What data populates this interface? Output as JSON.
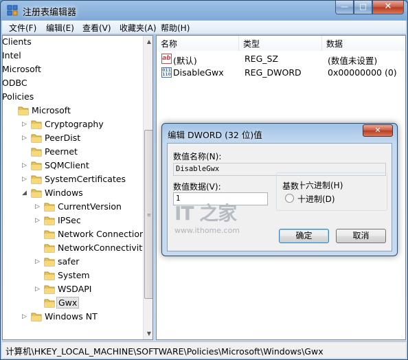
{
  "window": {
    "title": "注册表编辑器"
  },
  "titlebar": {
    "minimize": "—",
    "maximize": "□",
    "close": "✕"
  },
  "menu": [
    "文件(F)",
    "编辑(E)",
    "查看(V)",
    "收藏夹(A)",
    "帮助(H)"
  ],
  "tree": {
    "items": [
      {
        "label": "Clients",
        "level": 0,
        "expander": ""
      },
      {
        "label": "Intel",
        "level": 0,
        "expander": ""
      },
      {
        "label": "Microsoft",
        "level": 0,
        "expander": ""
      },
      {
        "label": "ODBC",
        "level": 0,
        "expander": ""
      },
      {
        "label": "Policies",
        "level": 0,
        "expander": ""
      },
      {
        "label": "Microsoft",
        "level": 1,
        "expander": ""
      },
      {
        "label": "Cryptography",
        "level": 2,
        "expander": "▷"
      },
      {
        "label": "PeerDist",
        "level": 2,
        "expander": "▷"
      },
      {
        "label": "Peernet",
        "level": 2,
        "expander": ""
      },
      {
        "label": "SQMClient",
        "level": 2,
        "expander": "▷"
      },
      {
        "label": "SystemCertificates",
        "level": 2,
        "expander": "▷"
      },
      {
        "label": "Windows",
        "level": 2,
        "expander": "◢"
      },
      {
        "label": "CurrentVersion",
        "level": 3,
        "expander": "▷"
      },
      {
        "label": "IPSec",
        "level": 3,
        "expander": "▷"
      },
      {
        "label": "Network Connections",
        "level": 3,
        "expander": ""
      },
      {
        "label": "NetworkConnectivityStat",
        "level": 3,
        "expander": ""
      },
      {
        "label": "safer",
        "level": 3,
        "expander": "▷"
      },
      {
        "label": "System",
        "level": 3,
        "expander": ""
      },
      {
        "label": "WSDAPI",
        "level": 3,
        "expander": "▷"
      },
      {
        "label": "Gwx",
        "level": 3,
        "expander": "",
        "selected": true
      },
      {
        "label": "Windows NT",
        "level": 2,
        "expander": "▷"
      }
    ],
    "scroll_up": "▲",
    "scroll_down": "▼",
    "scroll_grip": "≡"
  },
  "list": {
    "columns": [
      "名称",
      "类型",
      "数据"
    ],
    "rows": [
      {
        "icon": "string-value-icon",
        "icon_text": "ab",
        "name": "(默认)",
        "type": "REG_SZ",
        "data": "(数值未设置)"
      },
      {
        "icon": "binary-value-icon",
        "icon_text": "011\n110",
        "name": "DisableGwx",
        "type": "REG_DWORD",
        "data": "0x00000000 (0)"
      }
    ]
  },
  "statusbar": {
    "path": "计算机\\HKEY_LOCAL_MACHINE\\SOFTWARE\\Policies\\Microsoft\\Windows\\Gwx"
  },
  "dialog": {
    "title": "编辑 DWORD (32 位)值",
    "close": "✕",
    "name_label": "数值名称(N):",
    "name_value": "DisableGwx",
    "data_label": "数值数据(V):",
    "data_value": "1",
    "base_label": "基数",
    "radio_hex": "十六进制(H)",
    "radio_dec": "十进制(D)",
    "selected_base": "hex",
    "ok": "确定",
    "cancel": "取消",
    "watermark_logo": "IT 之家",
    "watermark_url": "www.ithome.com"
  }
}
